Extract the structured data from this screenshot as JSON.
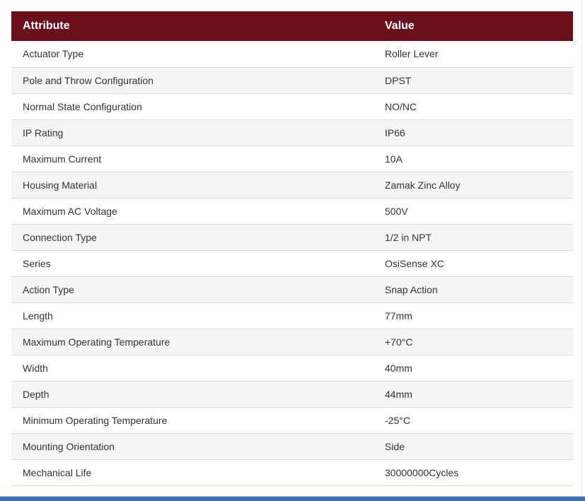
{
  "table": {
    "headers": {
      "attribute": "Attribute",
      "value": "Value"
    },
    "rows": [
      {
        "attribute": "Actuator Type",
        "value": "Roller Lever"
      },
      {
        "attribute": "Pole and Throw Configuration",
        "value": "DPST"
      },
      {
        "attribute": "Normal State Configuration",
        "value": "NO/NC"
      },
      {
        "attribute": "IP Rating",
        "value": "IP66"
      },
      {
        "attribute": "Maximum Current",
        "value": "10A"
      },
      {
        "attribute": "Housing Material",
        "value": "Zamak Zinc Alloy"
      },
      {
        "attribute": "Maximum AC Voltage",
        "value": "500V"
      },
      {
        "attribute": "Connection Type",
        "value": "1/2 in NPT"
      },
      {
        "attribute": "Series",
        "value": "OsiSense XC"
      },
      {
        "attribute": "Action Type",
        "value": "Snap Action"
      },
      {
        "attribute": "Length",
        "value": "77mm"
      },
      {
        "attribute": "Maximum Operating Temperature",
        "value": "+70°C"
      },
      {
        "attribute": "Width",
        "value": "40mm"
      },
      {
        "attribute": "Depth",
        "value": "44mm"
      },
      {
        "attribute": "Minimum Operating Temperature",
        "value": "-25°C"
      },
      {
        "attribute": "Mounting Orientation",
        "value": "Side"
      },
      {
        "attribute": "Mechanical Life",
        "value": "30000000Cycles"
      }
    ]
  },
  "colors": {
    "header_background": "#6b111e",
    "header_text": "#ffffff",
    "row_stripe": "#f5f5f5",
    "body_text": "#333333",
    "bottom_bar": "#3b6fad"
  }
}
